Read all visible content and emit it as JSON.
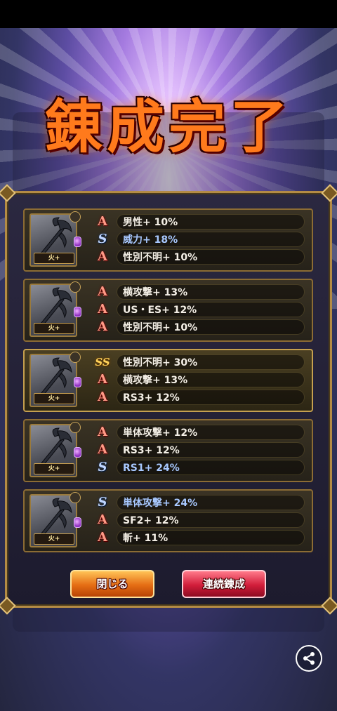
{
  "title": "錬成完了",
  "cards": [
    {
      "badge": "火+",
      "lines": [
        {
          "rank": "A",
          "text": "男性+ 10%"
        },
        {
          "rank": "S",
          "text": "威力+ 18%"
        },
        {
          "rank": "A",
          "text": "性別不明+ 10%"
        }
      ]
    },
    {
      "badge": "火+",
      "lines": [
        {
          "rank": "A",
          "text": "横攻撃+ 13%"
        },
        {
          "rank": "A",
          "text": "US・ES+ 12%"
        },
        {
          "rank": "A",
          "text": "性別不明+ 10%"
        }
      ]
    },
    {
      "badge": "火+",
      "lines": [
        {
          "rank": "SS",
          "text": "性別不明+ 30%"
        },
        {
          "rank": "A",
          "text": "横攻撃+ 13%"
        },
        {
          "rank": "A",
          "text": "RS3+ 12%"
        }
      ]
    },
    {
      "badge": "火+",
      "lines": [
        {
          "rank": "A",
          "text": "単体攻撃+ 12%"
        },
        {
          "rank": "A",
          "text": "RS3+ 12%"
        },
        {
          "rank": "S",
          "text": "RS1+ 24%"
        }
      ]
    },
    {
      "badge": "火+",
      "lines": [
        {
          "rank": "S",
          "text": "単体攻撃+ 24%"
        },
        {
          "rank": "A",
          "text": "SF2+ 12%"
        },
        {
          "rank": "A",
          "text": "斬+ 11%"
        }
      ]
    }
  ],
  "buttons": {
    "close_label": "閉じる",
    "repeat_label": "連続錬成"
  },
  "icons": {
    "share": "share-icon",
    "weapon": "battle-axe-icon"
  },
  "colors": {
    "rank_a": "#ff9a86",
    "rank_s": "#c0d6ff",
    "rank_ss": "#ffd25a",
    "close_button": "#e56d14",
    "repeat_button": "#d21d3a"
  }
}
